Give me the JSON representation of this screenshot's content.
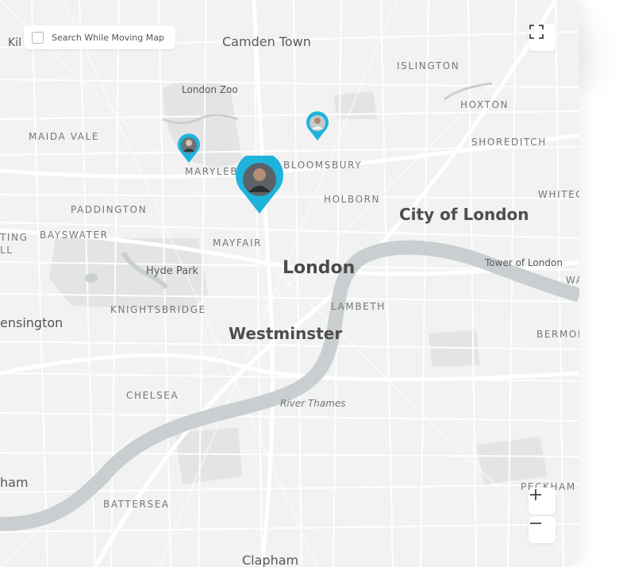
{
  "search_toggle": {
    "label": "Search While Moving Map",
    "checked": false
  },
  "controls": {
    "fullscreen_icon": "fullscreen-icon",
    "zoom_in_icon": "plus-icon",
    "zoom_out_icon": "minus-icon"
  },
  "labels": {
    "kil": "Kil",
    "camden_town": "Camden Town",
    "islington": "ISLINGTON",
    "london_zoo": "London Zoo",
    "hoxton": "HOXTON",
    "maida_vale": "MAIDA VALE",
    "shoreditch": "SHOREDITCH",
    "marylebone": "MARYLEB",
    "bloomsbury": "BLOOMSBURY",
    "whitechapel": "WHITEC",
    "holborn": "HOLBORN",
    "paddington": "PADDINGTON",
    "city_of_london": "City of London",
    "notting_a": "TING",
    "notting_b": "LL",
    "bayswater": "BAYSWATER",
    "mayfair": "MAYFAIR",
    "tower_of_london": "Tower of London",
    "wapping": "WA",
    "london": "London",
    "hyde_park": "Hyde Park",
    "knightsbridge": "KNIGHTSBRIDGE",
    "lambeth": "LAMBETH",
    "kensington": "ensington",
    "westminster": "Westminster",
    "bermondsey": "BERMON",
    "chelsea": "CHELSEA",
    "river_thames": "River Thames",
    "fulham": "ham",
    "peckham": "PECKHAM",
    "battersea": "BATTERSEA",
    "clapham": "Clapham"
  },
  "colors": {
    "background": "#f2f2f2",
    "road": "#ffffff",
    "river": "#c9cfd1",
    "park": "#e3e3e3",
    "pin": "#1fb3dc"
  },
  "pins": [
    {
      "name": "user-pin-small-west",
      "avatar": "avatar-icon"
    },
    {
      "name": "user-pin-small-east",
      "avatar": "avatar-icon"
    },
    {
      "name": "user-pin-large-selected",
      "avatar": "avatar-icon"
    }
  ]
}
